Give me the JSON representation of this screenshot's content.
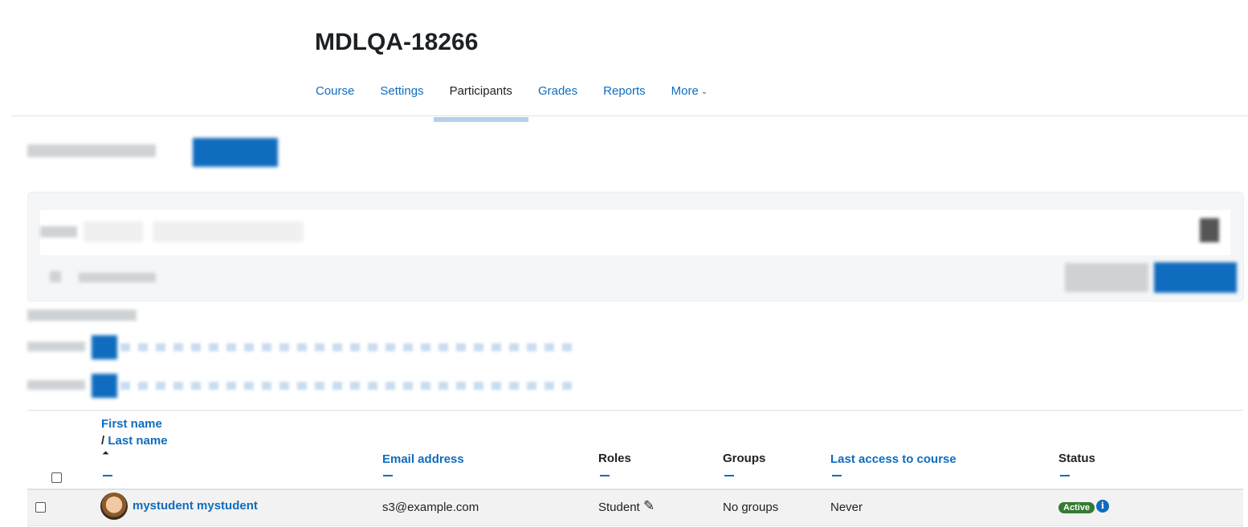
{
  "course_title": "MDLQA-18266",
  "nav": {
    "tabs": [
      "Course",
      "Settings",
      "Participants",
      "Grades",
      "Reports",
      "More"
    ],
    "active": "Participants",
    "more_chevron": "⌄"
  },
  "table": {
    "headers": {
      "first_name": "First name",
      "last_name_sep": "/ ",
      "last_name": "Last name",
      "email": "Email address",
      "roles": "Roles",
      "groups": "Groups",
      "last_access": "Last access to course",
      "status": "Status"
    },
    "rows": [
      {
        "name": "mystudent mystudent",
        "email": "s3@example.com",
        "role": "Student",
        "groups": "No groups",
        "last_access": "Never",
        "status": "Active"
      }
    ]
  },
  "icons": {
    "sort_asc": "⏶",
    "edit": "✎",
    "info": "i"
  },
  "colors": {
    "link": "#0f6cbf",
    "active_badge": "#357a32"
  }
}
